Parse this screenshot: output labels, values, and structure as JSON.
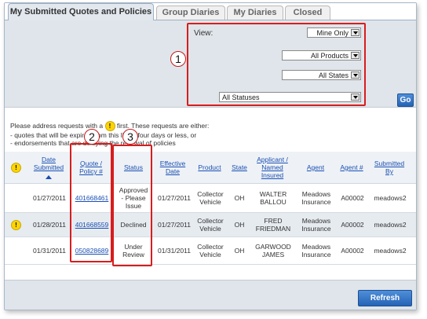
{
  "tabs": [
    {
      "label": "My Submitted Quotes and Policies",
      "active": true
    },
    {
      "label": "Group Diaries",
      "active": false
    },
    {
      "label": "My Diaries",
      "active": false
    },
    {
      "label": "Closed",
      "active": false
    }
  ],
  "filters": {
    "view_label": "View:",
    "view_value": "Mine Only",
    "product_value": "All Products",
    "state_value": "All States",
    "status_value": "All Statuses",
    "go_label": "Go"
  },
  "callouts": {
    "one": "1",
    "two": "2",
    "three": "3"
  },
  "notice": {
    "line1a": "Please address requests with a",
    "line1b": "first. These requests are either:",
    "line2": "- quotes that will be expired from this list in four days or less, or",
    "line3": "- endorsements that are delaying the renewal of policies",
    "icon_glyph": "!"
  },
  "table": {
    "headers": {
      "date_submitted": [
        "Date",
        "Submitted"
      ],
      "quote_policy": [
        "Quote /",
        "Policy #"
      ],
      "status": "Status",
      "effective_date": [
        "Effective",
        "Date"
      ],
      "product": "Product",
      "state": "State",
      "applicant": [
        "Applicant /",
        "Named",
        "Insured"
      ],
      "agent": "Agent",
      "agent_num": "Agent #",
      "submitted_by": [
        "Submitted",
        "By"
      ]
    },
    "rows": [
      {
        "flag": false,
        "date": "01/27/2011",
        "quote": "401668461",
        "status": [
          "Approved",
          "- Please",
          "Issue"
        ],
        "effective": "01/27/2011",
        "product": [
          "Collector",
          "Vehicle"
        ],
        "state": "OH",
        "applicant": [
          "WALTER",
          "BALLOU"
        ],
        "agent": [
          "Meadows",
          "Insurance"
        ],
        "agent_num": "A00002",
        "submitted_by": "meadows2"
      },
      {
        "flag": true,
        "date": "01/28/2011",
        "quote": "401668559",
        "status": [
          "Declined"
        ],
        "effective": "01/27/2011",
        "product": [
          "Collector",
          "Vehicle"
        ],
        "state": "OH",
        "applicant": [
          "FRED",
          "FRIEDMAN"
        ],
        "agent": [
          "Meadows",
          "Insurance"
        ],
        "agent_num": "A00002",
        "submitted_by": "meadows2"
      },
      {
        "flag": false,
        "date": "01/31/2011",
        "quote": "050828689",
        "status": [
          "Under",
          "Review"
        ],
        "effective": "01/31/2011",
        "product": [
          "Collector",
          "Vehicle"
        ],
        "state": "OH",
        "applicant": [
          "GARWOOD",
          "JAMES"
        ],
        "agent": [
          "Meadows",
          "Insurance"
        ],
        "agent_num": "A00002",
        "submitted_by": "meadows2"
      }
    ]
  },
  "refresh_label": "Refresh",
  "colors": {
    "accent": "#2563b5",
    "callout_red": "#d81d1d",
    "link": "#1a4fb3",
    "warning": "#ffd400"
  }
}
